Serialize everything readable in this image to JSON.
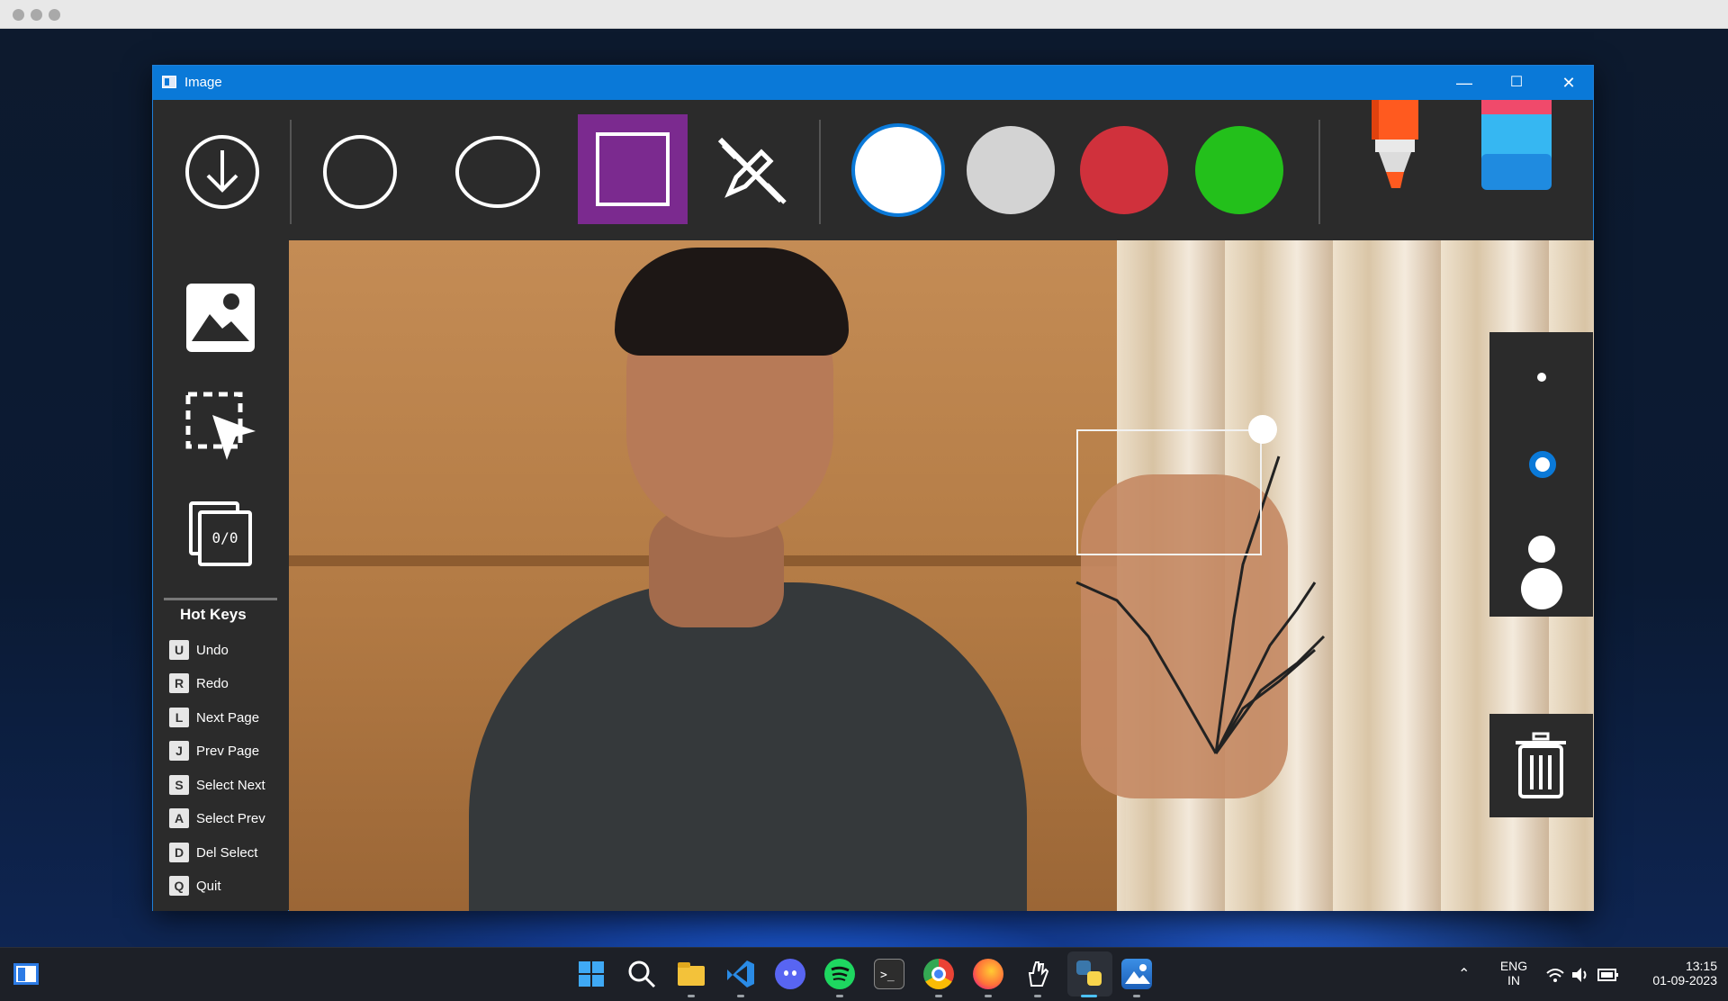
{
  "window": {
    "title": "Image",
    "minimize_glyph": "—",
    "maximize_glyph": "☐",
    "close_glyph": "✕"
  },
  "toolbar": {
    "items": [
      {
        "name": "save-download-icon"
      },
      {
        "name": "circle-tool-icon"
      },
      {
        "name": "ellipse-tool-icon"
      },
      {
        "name": "rectangle-tool-icon",
        "selected": true,
        "accent": "#7b2a8f"
      },
      {
        "name": "no-draw-pen-icon"
      }
    ],
    "colors": [
      {
        "name": "white",
        "hex": "#ffffff",
        "selected": true
      },
      {
        "name": "gray",
        "hex": "#d3d3d3"
      },
      {
        "name": "red",
        "hex": "#d0313c"
      },
      {
        "name": "green",
        "hex": "#23c01b"
      }
    ],
    "marker": "marker-icon",
    "eraser": "eraser-icon"
  },
  "sidebar": {
    "tools": [
      "image-icon",
      "select-arrow-icon",
      "pages-counter-icon"
    ],
    "page_counter": "0/0",
    "hot_keys_title": "Hot Keys",
    "hot_keys": [
      {
        "key": "U",
        "label": "Undo"
      },
      {
        "key": "R",
        "label": "Redo"
      },
      {
        "key": "L",
        "label": "Next Page"
      },
      {
        "key": "J",
        "label": "Prev Page"
      },
      {
        "key": "S",
        "label": "Select Next"
      },
      {
        "key": "A",
        "label": "Select Prev"
      },
      {
        "key": "D",
        "label": "Del Select"
      },
      {
        "key": "Q",
        "label": "Quit"
      }
    ]
  },
  "brush_sizes": {
    "options": [
      "size-1",
      "size-2",
      "size-3",
      "size-4"
    ],
    "selected_index": 1,
    "accent": "#0a79d8"
  },
  "taskbar": {
    "apps": [
      "start-icon",
      "search-icon",
      "file-explorer-icon",
      "vscode-icon",
      "discord-icon",
      "spotify-icon",
      "terminal-icon",
      "chrome-icon",
      "firefox-icon",
      "hand-gesture-icon",
      "python-icon",
      "photos-icon"
    ],
    "lang_line1": "ENG",
    "lang_line2": "IN",
    "time": "13:15",
    "date": "01-09-2023"
  }
}
